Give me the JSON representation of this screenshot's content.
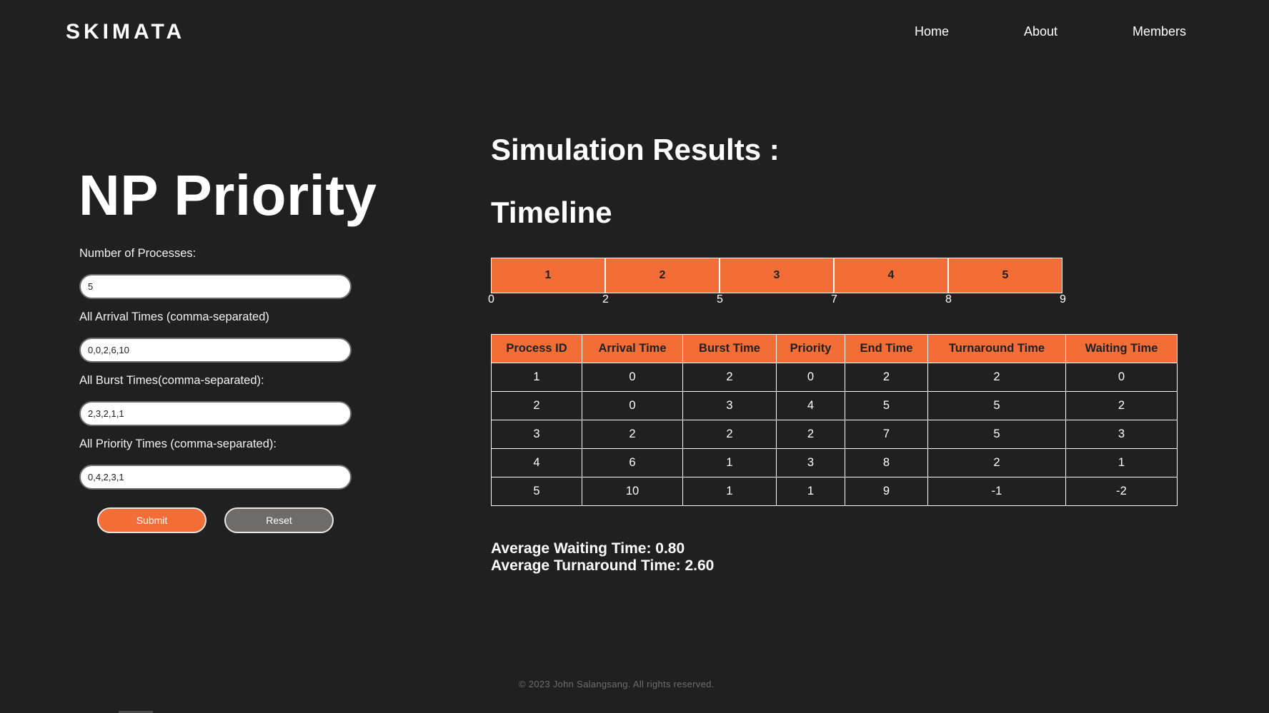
{
  "header": {
    "brand": "SKIMATA",
    "nav": {
      "home": "Home",
      "about": "About",
      "members": "Members"
    }
  },
  "form": {
    "title": "NP Priority",
    "num_processes": {
      "label": "Number of Processes:",
      "value": "5"
    },
    "arrival_times": {
      "label": "All Arrival Times (comma-separated)",
      "value": "0,0,2,6,10"
    },
    "burst_times": {
      "label": "All Burst Times(comma-separated):",
      "value": "2,3,2,1,1"
    },
    "priority_times": {
      "label": "All Priority Times (comma-separated):",
      "value": "0,4,2,3,1"
    },
    "submit_label": "Submit",
    "reset_label": "Reset"
  },
  "results": {
    "heading": "Simulation Results :",
    "timeline_heading": "Timeline",
    "gantt": [
      {
        "label": "1",
        "start": 0,
        "end": 2
      },
      {
        "label": "2",
        "start": 2,
        "end": 5
      },
      {
        "label": "3",
        "start": 5,
        "end": 7
      },
      {
        "label": "4",
        "start": 7,
        "end": 8
      },
      {
        "label": "5",
        "start": 8,
        "end": 9
      }
    ],
    "ticks": [
      "0",
      "2",
      "5",
      "7",
      "8",
      "9"
    ],
    "table": {
      "headers": [
        "Process ID",
        "Arrival Time",
        "Burst Time",
        "Priority",
        "End Time",
        "Turnaround Time",
        "Waiting Time"
      ],
      "rows": [
        [
          "1",
          "0",
          "2",
          "0",
          "2",
          "2",
          "0"
        ],
        [
          "2",
          "0",
          "3",
          "4",
          "5",
          "5",
          "2"
        ],
        [
          "3",
          "2",
          "2",
          "2",
          "7",
          "5",
          "3"
        ],
        [
          "4",
          "6",
          "1",
          "3",
          "8",
          "2",
          "1"
        ],
        [
          "5",
          "10",
          "1",
          "1",
          "9",
          "-1",
          "-2"
        ]
      ]
    },
    "avg_waiting": "Average Waiting Time: 0.80",
    "avg_turnaround": "Average Turnaround Time: 2.60"
  },
  "footer": {
    "copyright": "© 2023 John Salangsang. All rights reserved."
  },
  "colors": {
    "background": "#202020",
    "accent": "#f36e36",
    "reset_button": "#6e6b6b"
  }
}
